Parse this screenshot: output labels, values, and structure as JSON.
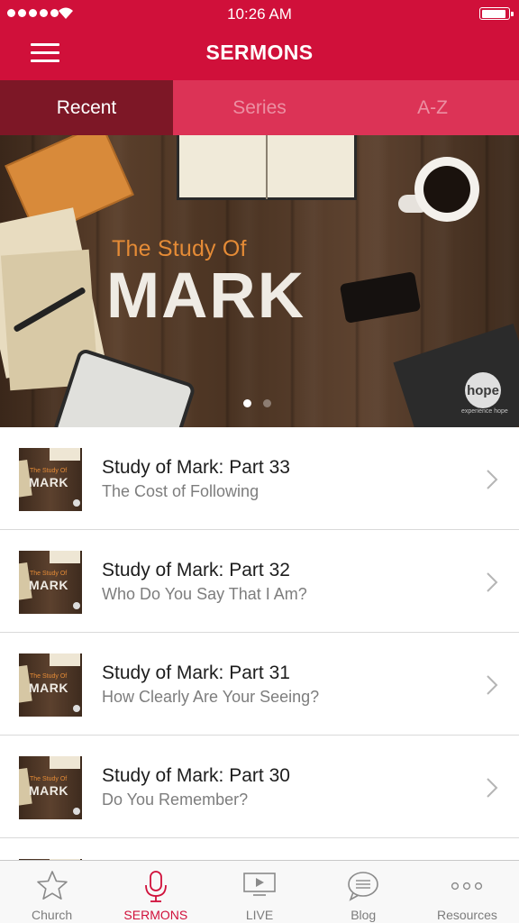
{
  "status_bar": {
    "time": "10:26 AM",
    "battery_level": 0.95
  },
  "nav": {
    "title": "SERMONS",
    "menu_icon": "hamburger-icon"
  },
  "tabs": [
    {
      "label": "Recent",
      "active": true
    },
    {
      "label": "Series",
      "active": false
    },
    {
      "label": "A-Z",
      "active": false
    }
  ],
  "hero": {
    "subtitle": "The Study Of",
    "title": "MARK",
    "logo_text": "hope",
    "logo_caption": "experience hope",
    "pager": {
      "count": 2,
      "current": 1
    }
  },
  "sermons": [
    {
      "title": "Study of Mark: Part 33",
      "subtitle": "The Cost of Following"
    },
    {
      "title": "Study of Mark: Part 32",
      "subtitle": "Who Do You Say That I Am?"
    },
    {
      "title": "Study of Mark: Part 31",
      "subtitle": "How Clearly Are Your Seeing?"
    },
    {
      "title": "Study of Mark: Part 30",
      "subtitle": "Do You Remember?"
    }
  ],
  "thumbnail": {
    "subtitle": "The Study Of",
    "title": "MARK"
  },
  "tab_bar": [
    {
      "label": "Church",
      "icon": "star-icon",
      "active": false
    },
    {
      "label": "SERMONS",
      "icon": "microphone-icon",
      "active": true
    },
    {
      "label": "LIVE",
      "icon": "video-play-icon",
      "active": false
    },
    {
      "label": "Blog",
      "icon": "speech-bubble-icon",
      "active": false
    },
    {
      "label": "Resources",
      "icon": "more-dots-icon",
      "active": false
    }
  ],
  "colors": {
    "brand": "#d0103a",
    "active_tab": "#7d1726",
    "accent_orange": "#e58b36"
  }
}
